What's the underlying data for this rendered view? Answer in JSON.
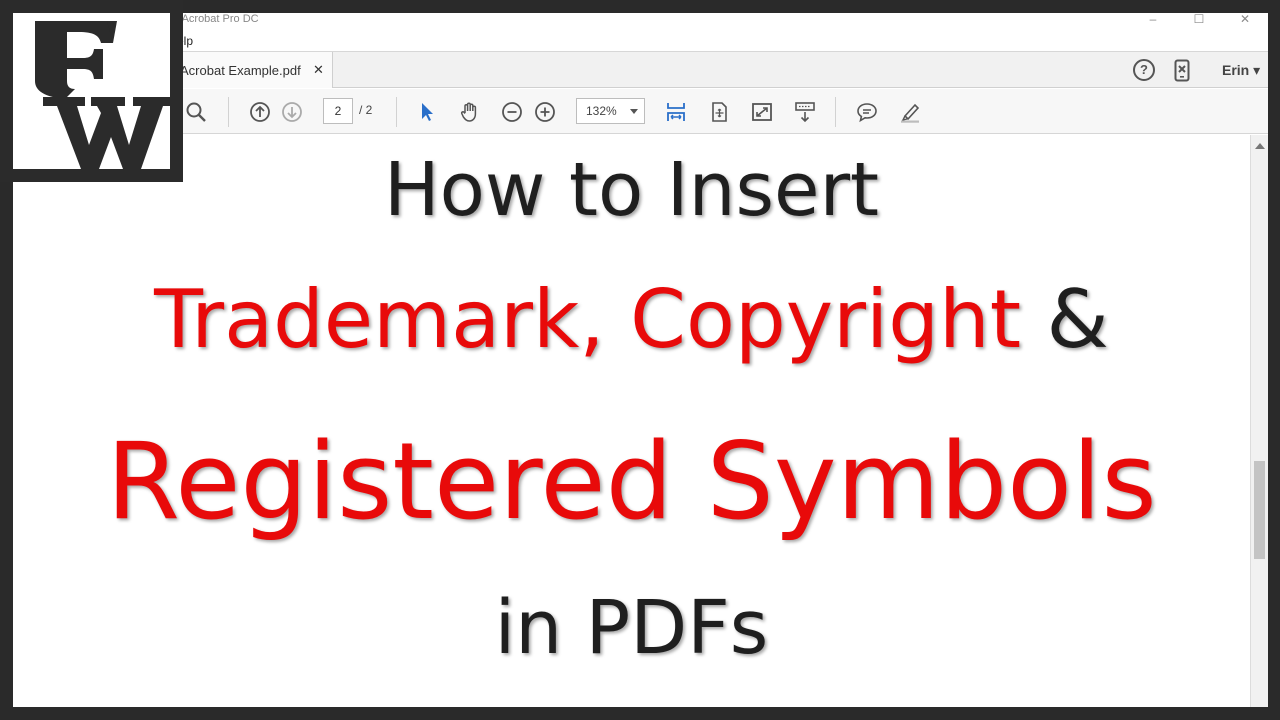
{
  "window": {
    "app_title": "e Acrobat Pro DC",
    "controls": {
      "minimize": "–",
      "maximize": "☐",
      "close": "✕"
    }
  },
  "menu": {
    "help_label": "elp"
  },
  "tab": {
    "document_name": "Acrobat Example.pdf",
    "close_glyph": "✕"
  },
  "header_right": {
    "help_glyph": "?",
    "user_name": "Erin ▾"
  },
  "toolbar": {
    "page_current": "2",
    "page_total": "/  2",
    "zoom": "132%"
  },
  "document": {
    "line1": "How to Insert",
    "line2_part1": "Trademark, ",
    "line2_part2": "Copyright ",
    "line2_part3": "&",
    "line3": "Registered Symbols",
    "line4": "in PDFs"
  },
  "logo": {
    "letters": "EW"
  },
  "colors": {
    "title_dark": "#1f1f1f",
    "title_red": "#e80a0a",
    "accent_blue": "#2a6fc9"
  },
  "icons": [
    "search-icon",
    "arrow-up-circle-icon",
    "arrow-down-circle-icon",
    "select-cursor-icon",
    "hand-tool-icon",
    "zoom-out-icon",
    "zoom-in-icon",
    "fit-width-icon",
    "fit-page-icon",
    "full-screen-icon",
    "read-mode-icon",
    "comment-icon",
    "highlight-pen-icon",
    "help-icon",
    "mobile-link-icon"
  ]
}
